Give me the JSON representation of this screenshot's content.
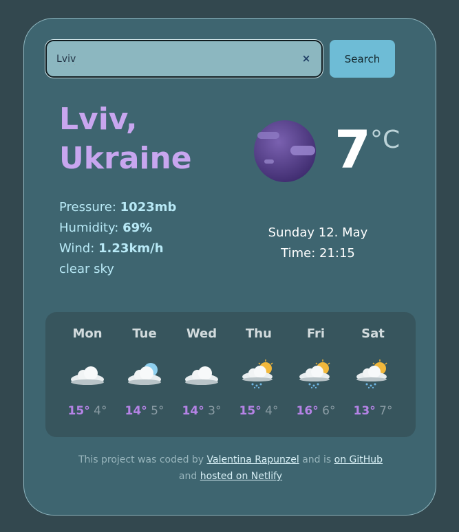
{
  "search": {
    "value": "Lviv",
    "clear_label": "×",
    "button_label": "Search"
  },
  "location": {
    "city": "Lviv,",
    "country": "Ukraine"
  },
  "details": {
    "pressure_label": "Pressure: ",
    "pressure_value": "1023mb",
    "humidity_label": "Humidity: ",
    "humidity_value": "69%",
    "wind_label": "Wind: ",
    "wind_value": "1.23km/h",
    "description": "clear sky"
  },
  "current": {
    "temperature": "7",
    "unit": "°C",
    "icon": "moon-icon",
    "date": "Sunday 12. May",
    "time": "Time: 21:15"
  },
  "forecast": [
    {
      "day": "Mon",
      "max": "15°",
      "min": "4°",
      "icon": "cloud-icon"
    },
    {
      "day": "Tue",
      "max": "14°",
      "min": "5°",
      "icon": "cloud-icon"
    },
    {
      "day": "Wed",
      "max": "14°",
      "min": "3°",
      "icon": "cloud-icon"
    },
    {
      "day": "Thu",
      "max": "15°",
      "min": "4°",
      "icon": "sun-rain-cloud-icon"
    },
    {
      "day": "Fri",
      "max": "16°",
      "min": "6°",
      "icon": "sun-rain-cloud-icon"
    },
    {
      "day": "Sat",
      "max": "13°",
      "min": "7°",
      "icon": "sun-rain-cloud-icon"
    }
  ],
  "footer": {
    "text1": "This project was coded by ",
    "author_link": "Valentina Rapunzel",
    "text2": " and is ",
    "github_link": "on GitHub",
    "text3": "and ",
    "netlify_link": "hosted on Netlify"
  },
  "colors": {
    "background": "#33484f",
    "card": "#3e6570",
    "city": "#c8a6ef",
    "details": "#b8e9f6",
    "max_temp": "#b583e6",
    "button": "#6ebcd6"
  }
}
